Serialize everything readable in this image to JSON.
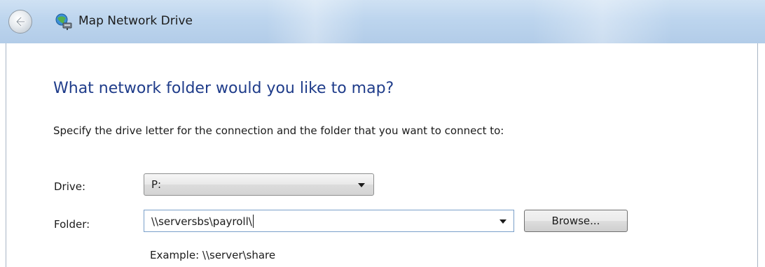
{
  "window": {
    "title": "Map Network Drive"
  },
  "heading": "What network folder would you like to map?",
  "instructions": "Specify the drive letter for the connection and the folder that you want to connect to:",
  "drive": {
    "label": "Drive:",
    "value": "P:"
  },
  "folder": {
    "label": "Folder:",
    "value": "\\\\serversbs\\payroll\\",
    "browse_label": "Browse..."
  },
  "example": "Example: \\\\server\\share",
  "colors": {
    "heading": "#1f3c8a",
    "titlebar": "#bdd5ee",
    "focus_border": "#7a9fc9"
  },
  "icons": {
    "back": "back-arrow-icon",
    "app": "network-drive-icon",
    "dropdown": "chevron-down-icon"
  }
}
